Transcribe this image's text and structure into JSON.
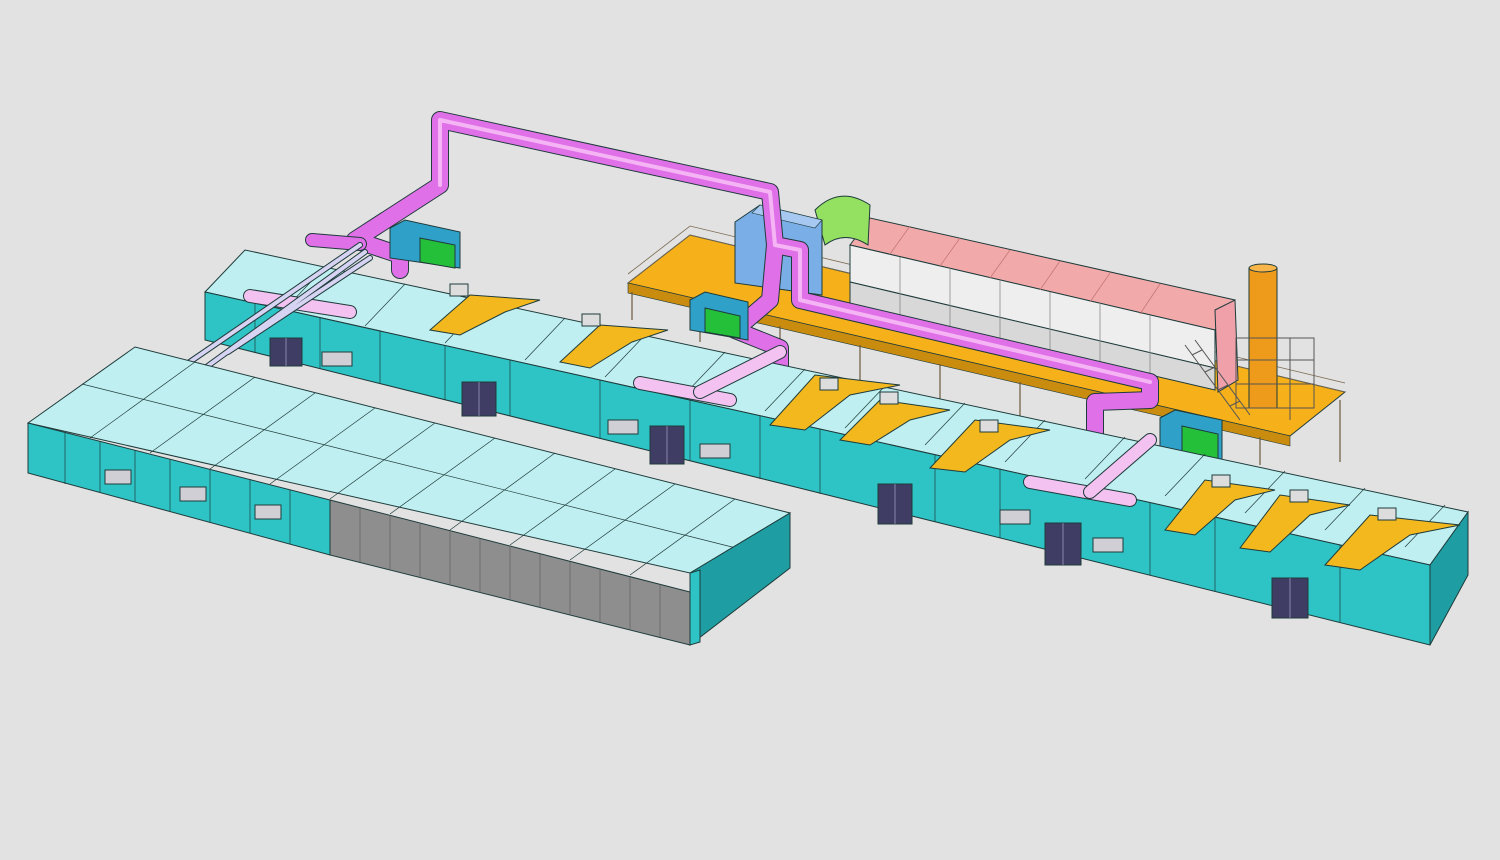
{
  "colors": {
    "background": "#e2e2e2",
    "booth_wall": "#2ec4c6",
    "booth_wall_dark": "#1e9ea2",
    "booth_roof": "#bfeff0",
    "exhaust_duct": "#e070e8",
    "branch_duct": "#f3c2f1",
    "supply_pipe": "#d7d3f3",
    "robot_arm": "#f2b81e",
    "platform": "#f5b01a",
    "door": "#3f3d63",
    "fan_unit_blue": "#2fa0c8",
    "fan_unit_green": "#24c03a",
    "collector": "#7aaee6",
    "rto_body": "#eeeeee",
    "rto_roof": "#f2a9a9",
    "stack": "#ee9a1a",
    "roller_door": "#8e8e8e",
    "green_bend": "#94e060"
  }
}
